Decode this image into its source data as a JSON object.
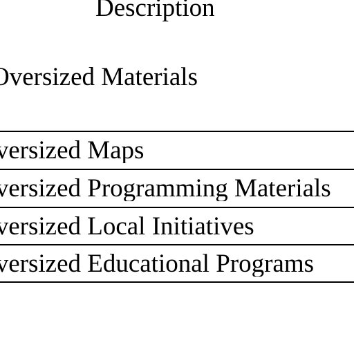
{
  "table": {
    "column_header": "Description",
    "section_title": "Oversized Materials",
    "rows": [
      {
        "text": "Oversized Maps"
      },
      {
        "text": "Oversized Programming Materials"
      },
      {
        "text": "Oversized Local Initiatives"
      },
      {
        "text": "Oversized Educational Programs"
      }
    ]
  }
}
